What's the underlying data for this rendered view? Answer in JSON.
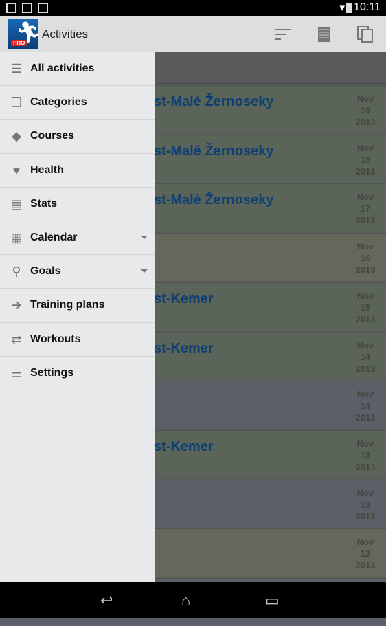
{
  "status": {
    "time": "10:11",
    "icons": [
      "signal-icon",
      "gmail-icon",
      "store-icon",
      "wifi-icon",
      "battery-icon"
    ]
  },
  "appbar": {
    "title": "Activities",
    "actions": [
      "sort-icon",
      "list-icon",
      "copy-icon"
    ],
    "logo_text": "PRO"
  },
  "drawer": {
    "items": [
      {
        "label": "All activities",
        "icon": "list-icon",
        "dropdown": false
      },
      {
        "label": "Categories",
        "icon": "categories-icon",
        "dropdown": false
      },
      {
        "label": "Courses",
        "icon": "course-icon",
        "dropdown": false
      },
      {
        "label": "Health",
        "icon": "heart-icon",
        "dropdown": false
      },
      {
        "label": "Stats",
        "icon": "stats-icon",
        "dropdown": false
      },
      {
        "label": "Calendar",
        "icon": "calendar-icon",
        "dropdown": true
      },
      {
        "label": "Goals",
        "icon": "pin-icon",
        "dropdown": true
      },
      {
        "label": "Training plans",
        "icon": "arrow-icon",
        "dropdown": false
      },
      {
        "label": "Workouts",
        "icon": "repeat-icon",
        "dropdown": false
      },
      {
        "label": "Settings",
        "icon": "sliders-icon",
        "dropdown": false
      }
    ]
  },
  "activities": [
    {
      "title": "st-Malé Žernoseky",
      "month": "Nov",
      "day": "19",
      "year": "2013",
      "color": "#5b6459"
    },
    {
      "title": "st-Malé Žernoseky",
      "month": "Nov",
      "day": "18",
      "year": "2013",
      "color": "#5b6459"
    },
    {
      "title": "st-Malé Žernoseky",
      "month": "Nov",
      "day": "17",
      "year": "2013",
      "color": "#5b6459"
    },
    {
      "title": "",
      "month": "Nov",
      "day": "16",
      "year": "2013",
      "color": "#67665a"
    },
    {
      "title": "st-Kemer",
      "month": "Nov",
      "day": "15",
      "year": "2013",
      "color": "#5b6459"
    },
    {
      "title": "st-Kemer",
      "month": "Nov",
      "day": "14",
      "year": "2013",
      "color": "#5b6459"
    },
    {
      "title": "",
      "month": "Nov",
      "day": "14",
      "year": "2013",
      "color": "#5b5f68"
    },
    {
      "title": "st-Kemer",
      "month": "Nov",
      "day": "13",
      "year": "2013",
      "color": "#5b6459"
    },
    {
      "title": "",
      "month": "Nov",
      "day": "13",
      "year": "2013",
      "color": "#5b5f68"
    },
    {
      "title": "",
      "month": "Nov",
      "day": "12",
      "year": "2013",
      "color": "#67665a"
    },
    {
      "title": "",
      "month": "",
      "day": "",
      "year": "",
      "color": "#5b5f68"
    }
  ]
}
